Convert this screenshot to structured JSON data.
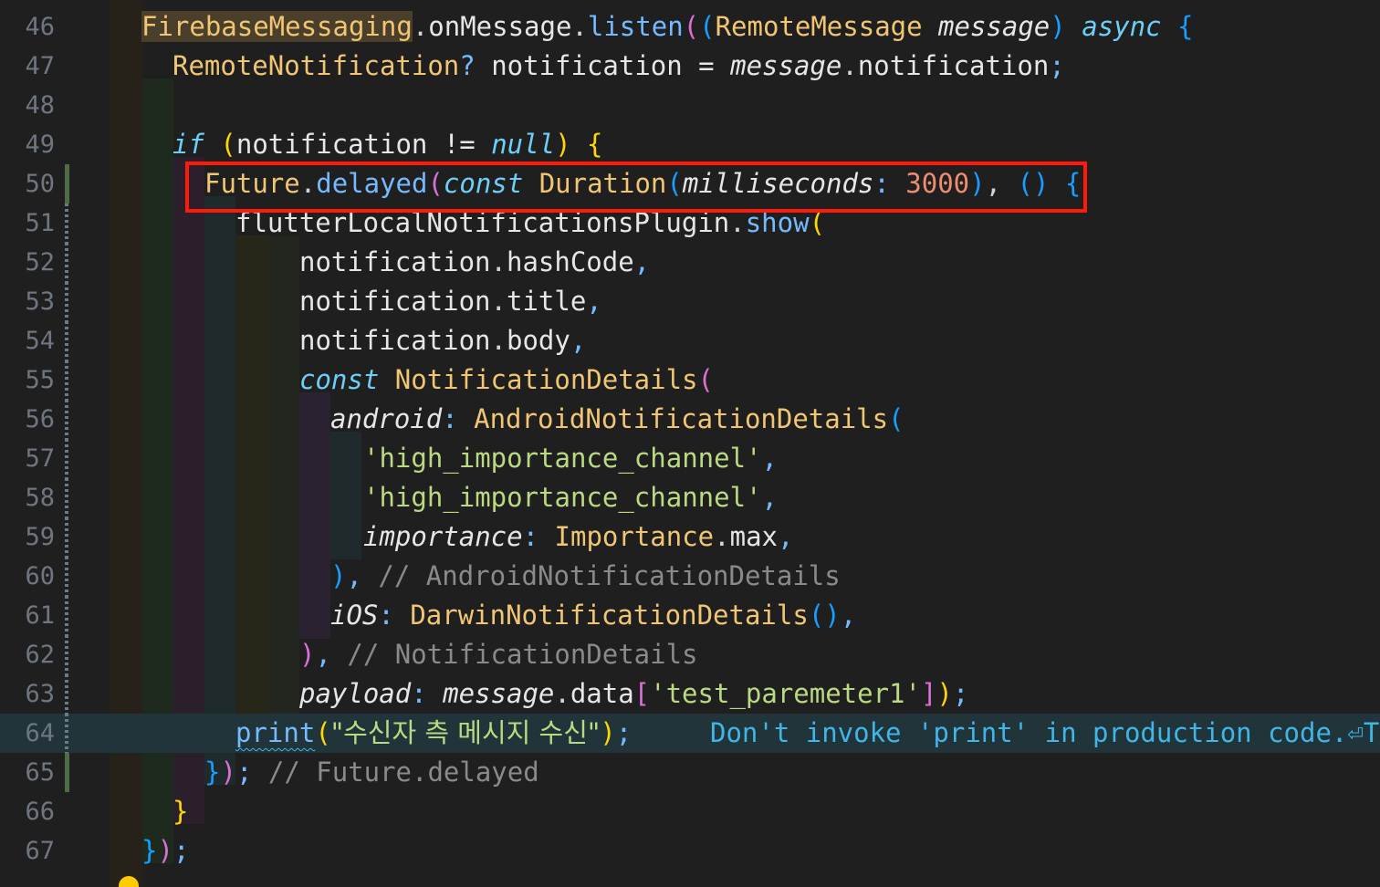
{
  "editor": {
    "line_numbers": [
      "46",
      "47",
      "48",
      "49",
      "50",
      "51",
      "52",
      "53",
      "54",
      "55",
      "56",
      "57",
      "58",
      "59",
      "60",
      "61",
      "62",
      "63",
      "64",
      "65",
      "66",
      "67"
    ],
    "lines": {
      "l46": {
        "a": "FirebaseMessaging",
        "b": ".",
        "c": "onMessage",
        "d": ".",
        "e": "listen",
        "f": "(",
        "g": "(",
        "h": "RemoteMessage",
        "i": " ",
        "j": "message",
        "k": ")",
        "l": " ",
        "m": "async",
        "n": " ",
        "o": "{"
      },
      "l47": {
        "a": "RemoteNotification",
        "b": "?",
        "c": " notification = ",
        "d": "message",
        "e": ".",
        "f": "notification",
        "g": ";"
      },
      "l49": {
        "a": "if",
        "b": " ",
        "c": "(",
        "d": "notification != ",
        "e": "null",
        "f": ")",
        "g": " ",
        "h": "{"
      },
      "l50": {
        "a": "Future",
        "b": ".",
        "c": "delayed",
        "d": "(",
        "e": "const",
        "f": " ",
        "g": "Duration",
        "h": "(",
        "i": "milliseconds",
        "j": ": ",
        "k": "3000",
        "l": ")",
        "m": ", ",
        "n": "()",
        "o": " ",
        "p": "{"
      },
      "l51": {
        "a": "flutterLocalNotificationsPlugin",
        "b": ".",
        "c": "show",
        "d": "("
      },
      "l52": {
        "a": "notification",
        "b": ".",
        "c": "hashCode",
        "d": ","
      },
      "l53": {
        "a": "notification",
        "b": ".",
        "c": "title",
        "d": ","
      },
      "l54": {
        "a": "notification",
        "b": ".",
        "c": "body",
        "d": ","
      },
      "l55": {
        "a": "const",
        "b": " ",
        "c": "NotificationDetails",
        "d": "("
      },
      "l56": {
        "a": "android",
        "b": ": ",
        "c": "AndroidNotificationDetails",
        "d": "("
      },
      "l57": {
        "a": "'high_importance_channel'",
        "b": ","
      },
      "l58": {
        "a": "'high_importance_channel'",
        "b": ","
      },
      "l59": {
        "a": "importance",
        "b": ": ",
        "c": "Importance",
        "d": ".",
        "e": "max",
        "f": ","
      },
      "l60": {
        "a": ")",
        "b": ",",
        "c": " // AndroidNotificationDetails"
      },
      "l61": {
        "a": "iOS",
        "b": ": ",
        "c": "DarwinNotificationDetails",
        "d": "()",
        "e": ","
      },
      "l62": {
        "a": ")",
        "b": ",",
        "c": " // NotificationDetails"
      },
      "l63": {
        "a": "payload",
        "b": ": ",
        "c": "message",
        "d": ".",
        "e": "data",
        "f": "[",
        "g": "'test_paremeter1'",
        "h": "]",
        "i": ")",
        "j": ";"
      },
      "l64": {
        "a": "print",
        "b": "(",
        "c": "\"수신자 측 메시지 수신\"",
        "d": ")",
        "e": ";",
        "hint": "Don't invoke 'print' in production code.⏎Tr"
      },
      "l65": {
        "a": "}",
        "b": ")",
        "c": ";",
        "d": " // Future.delayed"
      },
      "l66": {
        "a": "}"
      },
      "l67": {
        "a": "}",
        "b": ")",
        "c": ";"
      }
    }
  },
  "colors": {
    "background": "#1f1f1f",
    "highlight_box": "#ff1a0a",
    "line_number": "#6e7681",
    "class": "#f0c674",
    "function": "#75b9ff",
    "keyword": "#6ecff6",
    "number": "#f08d6f",
    "string": "#b9d982",
    "comment": "#8a8a8a",
    "hint": "#3fb6e6"
  },
  "icons": {
    "lightbulb": "lightbulb-icon"
  }
}
